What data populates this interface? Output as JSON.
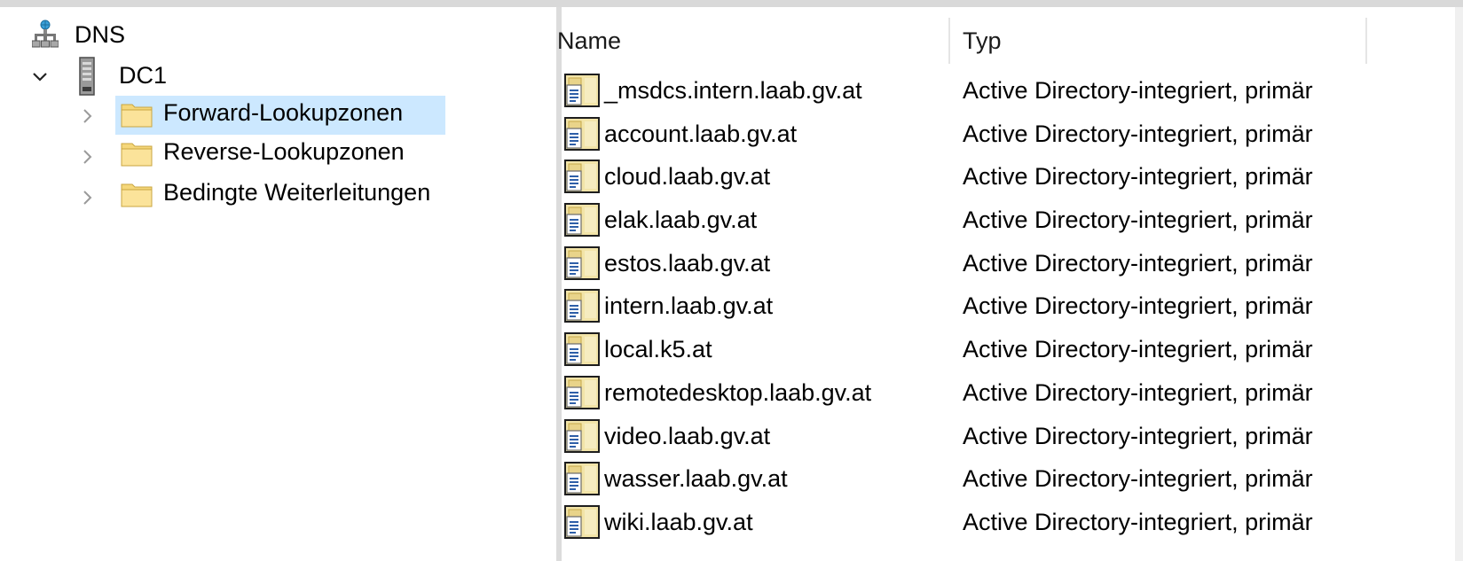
{
  "tree": {
    "root": {
      "label": "DNS",
      "icon": "dns-network-icon"
    },
    "server": {
      "label": "DC1",
      "icon": "server-icon",
      "expanded": true
    },
    "children": [
      {
        "label": "Forward-Lookupzonen",
        "icon": "folder-icon",
        "selected": true
      },
      {
        "label": "Reverse-Lookupzonen",
        "icon": "folder-icon",
        "selected": false
      },
      {
        "label": "Bedingte Weiterleitungen",
        "icon": "folder-icon",
        "selected": false
      }
    ]
  },
  "list": {
    "columns": [
      "Name",
      "Typ"
    ],
    "rows": [
      {
        "name": "_msdcs.intern.laab.gv.at",
        "type": "Active Directory-integriert, primär"
      },
      {
        "name": "account.laab.gv.at",
        "type": "Active Directory-integriert, primär"
      },
      {
        "name": "cloud.laab.gv.at",
        "type": "Active Directory-integriert, primär"
      },
      {
        "name": "elak.laab.gv.at",
        "type": "Active Directory-integriert, primär"
      },
      {
        "name": "estos.laab.gv.at",
        "type": "Active Directory-integriert, primär"
      },
      {
        "name": "intern.laab.gv.at",
        "type": "Active Directory-integriert, primär"
      },
      {
        "name": "local.k5.at",
        "type": "Active Directory-integriert, primär"
      },
      {
        "name": "remotedesktop.laab.gv.at",
        "type": "Active Directory-integriert, primär"
      },
      {
        "name": "video.laab.gv.at",
        "type": "Active Directory-integriert, primär"
      },
      {
        "name": "wasser.laab.gv.at",
        "type": "Active Directory-integriert, primär"
      },
      {
        "name": "wiki.laab.gv.at",
        "type": "Active Directory-integriert, primär"
      }
    ],
    "row_icon": "zone-file-icon"
  },
  "colors": {
    "selection": "#cce8ff",
    "folder": "#f5d77a",
    "zone_icon_frame": "#1e1e1e",
    "zone_icon_fill": "#f2e4a8"
  }
}
